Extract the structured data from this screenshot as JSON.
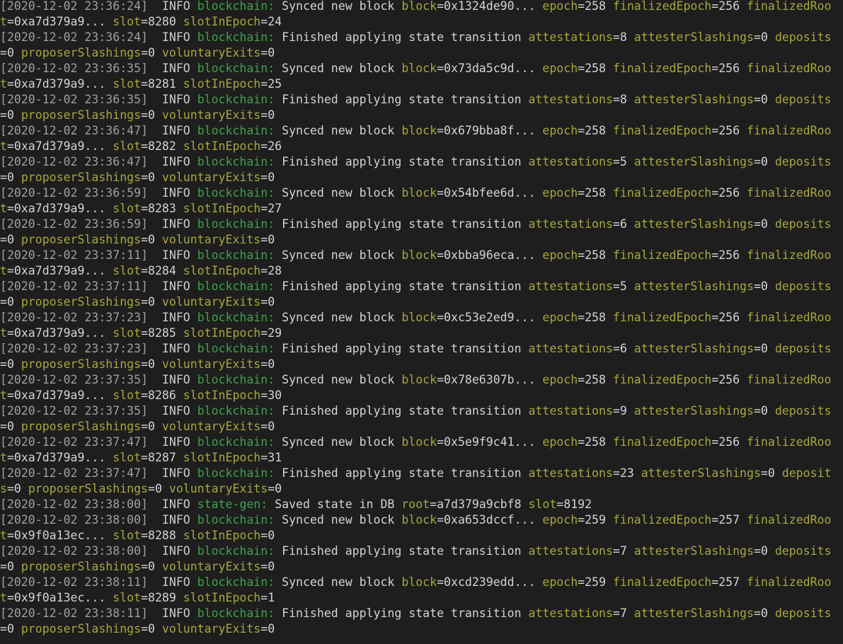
{
  "terminal": {
    "entries": [
      {
        "time": "[2020-12-02 23:36:24]",
        "level": "INFO",
        "component": "blockchain:",
        "message": "Synced new block",
        "fields": [
          {
            "k": "block",
            "v": "0x1324de90..."
          },
          {
            "k": "epoch",
            "v": "258"
          },
          {
            "k": "finalizedEpoch",
            "v": "256"
          },
          {
            "k": "finalizedRoot",
            "v": "0xa7d379a9..."
          },
          {
            "k": "slot",
            "v": "8280"
          },
          {
            "k": "slotInEpoch",
            "v": "24"
          }
        ]
      },
      {
        "time": "[2020-12-02 23:36:24]",
        "level": "INFO",
        "component": "blockchain:",
        "message": "Finished applying state transition",
        "fields": [
          {
            "k": "attestations",
            "v": "8"
          },
          {
            "k": "attesterSlashings",
            "v": "0"
          },
          {
            "k": "deposits",
            "v": "0"
          },
          {
            "k": "proposerSlashings",
            "v": "0"
          },
          {
            "k": "voluntaryExits",
            "v": "0"
          }
        ]
      },
      {
        "time": "[2020-12-02 23:36:35]",
        "level": "INFO",
        "component": "blockchain:",
        "message": "Synced new block",
        "fields": [
          {
            "k": "block",
            "v": "0x73da5c9d..."
          },
          {
            "k": "epoch",
            "v": "258"
          },
          {
            "k": "finalizedEpoch",
            "v": "256"
          },
          {
            "k": "finalizedRoot",
            "v": "0xa7d379a9..."
          },
          {
            "k": "slot",
            "v": "8281"
          },
          {
            "k": "slotInEpoch",
            "v": "25"
          }
        ]
      },
      {
        "time": "[2020-12-02 23:36:35]",
        "level": "INFO",
        "component": "blockchain:",
        "message": "Finished applying state transition",
        "fields": [
          {
            "k": "attestations",
            "v": "8"
          },
          {
            "k": "attesterSlashings",
            "v": "0"
          },
          {
            "k": "deposits",
            "v": "0"
          },
          {
            "k": "proposerSlashings",
            "v": "0"
          },
          {
            "k": "voluntaryExits",
            "v": "0"
          }
        ]
      },
      {
        "time": "[2020-12-02 23:36:47]",
        "level": "INFO",
        "component": "blockchain:",
        "message": "Synced new block",
        "fields": [
          {
            "k": "block",
            "v": "0x679bba8f..."
          },
          {
            "k": "epoch",
            "v": "258"
          },
          {
            "k": "finalizedEpoch",
            "v": "256"
          },
          {
            "k": "finalizedRoot",
            "v": "0xa7d379a9..."
          },
          {
            "k": "slot",
            "v": "8282"
          },
          {
            "k": "slotInEpoch",
            "v": "26"
          }
        ]
      },
      {
        "time": "[2020-12-02 23:36:47]",
        "level": "INFO",
        "component": "blockchain:",
        "message": "Finished applying state transition",
        "fields": [
          {
            "k": "attestations",
            "v": "5"
          },
          {
            "k": "attesterSlashings",
            "v": "0"
          },
          {
            "k": "deposits",
            "v": "0"
          },
          {
            "k": "proposerSlashings",
            "v": "0"
          },
          {
            "k": "voluntaryExits",
            "v": "0"
          }
        ]
      },
      {
        "time": "[2020-12-02 23:36:59]",
        "level": "INFO",
        "component": "blockchain:",
        "message": "Synced new block",
        "fields": [
          {
            "k": "block",
            "v": "0x54bfee6d..."
          },
          {
            "k": "epoch",
            "v": "258"
          },
          {
            "k": "finalizedEpoch",
            "v": "256"
          },
          {
            "k": "finalizedRoot",
            "v": "0xa7d379a9..."
          },
          {
            "k": "slot",
            "v": "8283"
          },
          {
            "k": "slotInEpoch",
            "v": "27"
          }
        ]
      },
      {
        "time": "[2020-12-02 23:36:59]",
        "level": "INFO",
        "component": "blockchain:",
        "message": "Finished applying state transition",
        "fields": [
          {
            "k": "attestations",
            "v": "6"
          },
          {
            "k": "attesterSlashings",
            "v": "0"
          },
          {
            "k": "deposits",
            "v": "0"
          },
          {
            "k": "proposerSlashings",
            "v": "0"
          },
          {
            "k": "voluntaryExits",
            "v": "0"
          }
        ]
      },
      {
        "time": "[2020-12-02 23:37:11]",
        "level": "INFO",
        "component": "blockchain:",
        "message": "Synced new block",
        "fields": [
          {
            "k": "block",
            "v": "0xbba96eca..."
          },
          {
            "k": "epoch",
            "v": "258"
          },
          {
            "k": "finalizedEpoch",
            "v": "256"
          },
          {
            "k": "finalizedRoot",
            "v": "0xa7d379a9..."
          },
          {
            "k": "slot",
            "v": "8284"
          },
          {
            "k": "slotInEpoch",
            "v": "28"
          }
        ]
      },
      {
        "time": "[2020-12-02 23:37:11]",
        "level": "INFO",
        "component": "blockchain:",
        "message": "Finished applying state transition",
        "fields": [
          {
            "k": "attestations",
            "v": "5"
          },
          {
            "k": "attesterSlashings",
            "v": "0"
          },
          {
            "k": "deposits",
            "v": "0"
          },
          {
            "k": "proposerSlashings",
            "v": "0"
          },
          {
            "k": "voluntaryExits",
            "v": "0"
          }
        ]
      },
      {
        "time": "[2020-12-02 23:37:23]",
        "level": "INFO",
        "component": "blockchain:",
        "message": "Synced new block",
        "fields": [
          {
            "k": "block",
            "v": "0xc53e2ed9..."
          },
          {
            "k": "epoch",
            "v": "258"
          },
          {
            "k": "finalizedEpoch",
            "v": "256"
          },
          {
            "k": "finalizedRoot",
            "v": "0xa7d379a9..."
          },
          {
            "k": "slot",
            "v": "8285"
          },
          {
            "k": "slotInEpoch",
            "v": "29"
          }
        ]
      },
      {
        "time": "[2020-12-02 23:37:23]",
        "level": "INFO",
        "component": "blockchain:",
        "message": "Finished applying state transition",
        "fields": [
          {
            "k": "attestations",
            "v": "6"
          },
          {
            "k": "attesterSlashings",
            "v": "0"
          },
          {
            "k": "deposits",
            "v": "0"
          },
          {
            "k": "proposerSlashings",
            "v": "0"
          },
          {
            "k": "voluntaryExits",
            "v": "0"
          }
        ]
      },
      {
        "time": "[2020-12-02 23:37:35]",
        "level": "INFO",
        "component": "blockchain:",
        "message": "Synced new block",
        "fields": [
          {
            "k": "block",
            "v": "0x78e6307b..."
          },
          {
            "k": "epoch",
            "v": "258"
          },
          {
            "k": "finalizedEpoch",
            "v": "256"
          },
          {
            "k": "finalizedRoot",
            "v": "0xa7d379a9..."
          },
          {
            "k": "slot",
            "v": "8286"
          },
          {
            "k": "slotInEpoch",
            "v": "30"
          }
        ]
      },
      {
        "time": "[2020-12-02 23:37:35]",
        "level": "INFO",
        "component": "blockchain:",
        "message": "Finished applying state transition",
        "fields": [
          {
            "k": "attestations",
            "v": "9"
          },
          {
            "k": "attesterSlashings",
            "v": "0"
          },
          {
            "k": "deposits",
            "v": "0"
          },
          {
            "k": "proposerSlashings",
            "v": "0"
          },
          {
            "k": "voluntaryExits",
            "v": "0"
          }
        ]
      },
      {
        "time": "[2020-12-02 23:37:47]",
        "level": "INFO",
        "component": "blockchain:",
        "message": "Synced new block",
        "fields": [
          {
            "k": "block",
            "v": "0x5e9f9c41..."
          },
          {
            "k": "epoch",
            "v": "258"
          },
          {
            "k": "finalizedEpoch",
            "v": "256"
          },
          {
            "k": "finalizedRoot",
            "v": "0xa7d379a9..."
          },
          {
            "k": "slot",
            "v": "8287"
          },
          {
            "k": "slotInEpoch",
            "v": "31"
          }
        ]
      },
      {
        "time": "[2020-12-02 23:37:47]",
        "level": "INFO",
        "component": "blockchain:",
        "message": "Finished applying state transition",
        "fields": [
          {
            "k": "attestations",
            "v": "23"
          },
          {
            "k": "attesterSlashings",
            "v": "0"
          },
          {
            "k": "deposits",
            "v": "0"
          },
          {
            "k": "proposerSlashings",
            "v": "0"
          },
          {
            "k": "voluntaryExits",
            "v": "0"
          }
        ]
      },
      {
        "time": "[2020-12-02 23:38:00]",
        "level": "INFO",
        "component": "state-gen:",
        "message": "Saved state in DB",
        "fields": [
          {
            "k": "root",
            "v": "a7d379a9cbf8"
          },
          {
            "k": "slot",
            "v": "8192"
          }
        ]
      },
      {
        "time": "[2020-12-02 23:38:00]",
        "level": "INFO",
        "component": "blockchain:",
        "message": "Synced new block",
        "fields": [
          {
            "k": "block",
            "v": "0xa653dccf..."
          },
          {
            "k": "epoch",
            "v": "259"
          },
          {
            "k": "finalizedEpoch",
            "v": "257"
          },
          {
            "k": "finalizedRoot",
            "v": "0x9f0a13ec..."
          },
          {
            "k": "slot",
            "v": "8288"
          },
          {
            "k": "slotInEpoch",
            "v": "0"
          }
        ]
      },
      {
        "time": "[2020-12-02 23:38:00]",
        "level": "INFO",
        "component": "blockchain:",
        "message": "Finished applying state transition",
        "fields": [
          {
            "k": "attestations",
            "v": "7"
          },
          {
            "k": "attesterSlashings",
            "v": "0"
          },
          {
            "k": "deposits",
            "v": "0"
          },
          {
            "k": "proposerSlashings",
            "v": "0"
          },
          {
            "k": "voluntaryExits",
            "v": "0"
          }
        ]
      },
      {
        "time": "[2020-12-02 23:38:11]",
        "level": "INFO",
        "component": "blockchain:",
        "message": "Synced new block",
        "fields": [
          {
            "k": "block",
            "v": "0xcd239edd..."
          },
          {
            "k": "epoch",
            "v": "259"
          },
          {
            "k": "finalizedEpoch",
            "v": "257"
          },
          {
            "k": "finalizedRoot",
            "v": "0x9f0a13ec..."
          },
          {
            "k": "slot",
            "v": "8289"
          },
          {
            "k": "slotInEpoch",
            "v": "1"
          }
        ]
      },
      {
        "time": "[2020-12-02 23:38:11]",
        "level": "INFO",
        "component": "blockchain:",
        "message": "Finished applying state transition",
        "fields": [
          {
            "k": "attestations",
            "v": "7"
          },
          {
            "k": "attesterSlashings",
            "v": "0"
          },
          {
            "k": "deposits",
            "v": "0"
          },
          {
            "k": "proposerSlashings",
            "v": "0"
          },
          {
            "k": "voluntaryExits",
            "v": "0"
          }
        ]
      }
    ]
  }
}
